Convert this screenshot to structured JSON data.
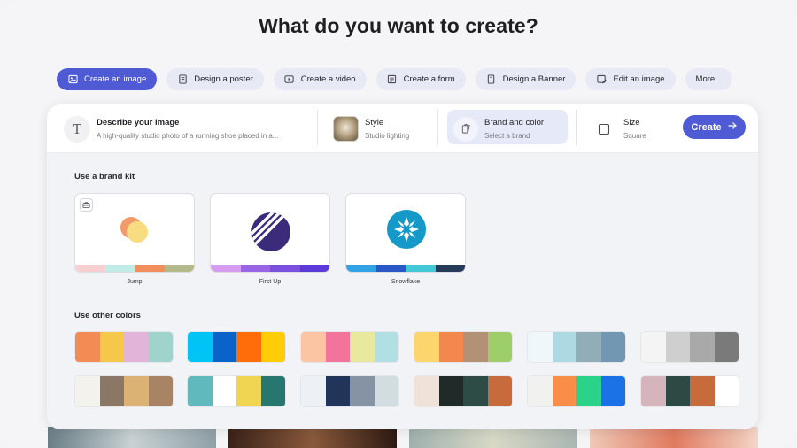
{
  "page": {
    "heading": "What do you want to create?"
  },
  "chips": [
    {
      "label": "Create an image",
      "icon": "image-icon",
      "active": true
    },
    {
      "label": "Design a poster",
      "icon": "document-icon",
      "active": false
    },
    {
      "label": "Create a video",
      "icon": "video-icon",
      "active": false
    },
    {
      "label": "Create a form",
      "icon": "form-icon",
      "active": false
    },
    {
      "label": "Design a Banner",
      "icon": "banner-icon",
      "active": false
    },
    {
      "label": "Edit an image",
      "icon": "edit-image-icon",
      "active": false
    },
    {
      "label": "More...",
      "icon": "",
      "active": false
    }
  ],
  "toolbar": {
    "describe": {
      "title": "Describe your image",
      "value": "A high-quality studio photo of a running shoe placed in a..."
    },
    "style": {
      "title": "Style",
      "value": "Studio lighting"
    },
    "brand": {
      "title": "Brand and color",
      "value": "Select a brand"
    },
    "size": {
      "title": "Size",
      "value": "Square"
    },
    "create_label": "Create"
  },
  "brand_section": {
    "label": "Use a brand kit",
    "kits": [
      {
        "name": "Jump",
        "logo": "jump-logo",
        "colors": [
          "#f8cfd0",
          "#bfece6",
          "#f38e5d",
          "#b5b989"
        ]
      },
      {
        "name": "First Up",
        "logo": "first-up-logo",
        "colors": [
          "#d79bf0",
          "#9a64e6",
          "#7b4fe0",
          "#5b3ad9"
        ]
      },
      {
        "name": "Snowflake",
        "logo": "snowflake-logo",
        "colors": [
          "#2fa3e6",
          "#2a56c8",
          "#43c8d8",
          "#263a5a"
        ]
      }
    ]
  },
  "other_colors": {
    "label": "Use other colors",
    "palettes": [
      [
        "#f38b55",
        "#f6c84a",
        "#e3b4da",
        "#9fd3cb"
      ],
      [
        "#00c4f5",
        "#0a63c8",
        "#ff6d0b",
        "#ffcc08"
      ],
      [
        "#fdc4a3",
        "#f2749c",
        "#e8e89f",
        "#b2dfe3"
      ],
      [
        "#fcd66c",
        "#f3884f",
        "#b29177",
        "#9ece6a"
      ],
      [
        "#eff7fb",
        "#add9e3",
        "#91aeb8",
        "#7197b2"
      ],
      [
        "#f4f4f4",
        "#cfcfcf",
        "#a9a9a9",
        "#7a7a7a"
      ],
      [
        "#f3f2ec",
        "#8a7766",
        "#dcb274",
        "#a88364"
      ],
      [
        "#5fb9bd",
        "#ffffff",
        "#f0d553",
        "#287670"
      ],
      [
        "#edf0f4",
        "#213459",
        "#8593a5",
        "#d2dde2"
      ],
      [
        "#f0e2d9",
        "#202a28",
        "#2d4c45",
        "#c86b3c"
      ],
      [
        "#f1f1ef",
        "#f98e48",
        "#2bd38a",
        "#1b72e6"
      ],
      [
        "#d6b4bb",
        "#2c4a43",
        "#c86b3c",
        "#ffffff"
      ]
    ]
  }
}
